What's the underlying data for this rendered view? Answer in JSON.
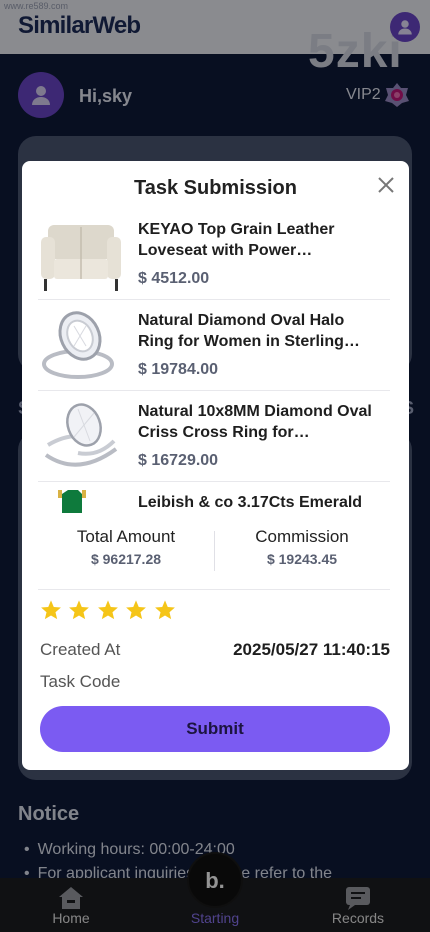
{
  "topbar": {
    "watermark": "www.re589.com",
    "logo_text": "SimilarWeb",
    "brand_mark": "5zki"
  },
  "user": {
    "greeting": "Hi,sky",
    "vip_level": "VIP2"
  },
  "background_hints": {
    "left_char": "S",
    "right_char": "S"
  },
  "notice": {
    "title": "Notice",
    "items": [
      "Working hours: 00:00-24:00",
      "For applicant inquiries, please refer to the"
    ]
  },
  "bottom_nav": {
    "items": [
      {
        "label": "Home",
        "icon": "home-icon"
      },
      {
        "label": "Starting",
        "icon": "start-icon",
        "active": true
      },
      {
        "label": "Records",
        "icon": "records-icon"
      }
    ],
    "center_button": "b."
  },
  "modal": {
    "title": "Task Submission",
    "products": [
      {
        "name": "KEYAO Top Grain Leather Loveseat with Power…",
        "price": "$ 4512.00",
        "image": "leather-loveseat-image"
      },
      {
        "name": "Natural Diamond Oval Halo Ring for Women in Sterling…",
        "price": "$ 19784.00",
        "image": "diamond-halo-ring-image"
      },
      {
        "name": "Natural 10x8MM Diamond Oval Criss Cross Ring for…",
        "price": "$ 16729.00",
        "image": "criss-cross-ring-image"
      },
      {
        "name": "Leibish & co 3.17Cts Emerald",
        "price": "",
        "image": "emerald-ring-image"
      }
    ],
    "total_amount": {
      "label": "Total Amount",
      "value": "$ 96217.28"
    },
    "commission": {
      "label": "Commission",
      "value": "$ 19243.45"
    },
    "rating": 5,
    "created_at": {
      "label": "Created At",
      "value": "2025/05/27 11:40:15"
    },
    "task_code": {
      "label": "Task Code",
      "value": ""
    },
    "submit_label": "Submit"
  },
  "colors": {
    "accent": "#7b5bf2",
    "background": "#0f1a3a",
    "star": "#f5c518",
    "avatar": "#6a45c8"
  }
}
